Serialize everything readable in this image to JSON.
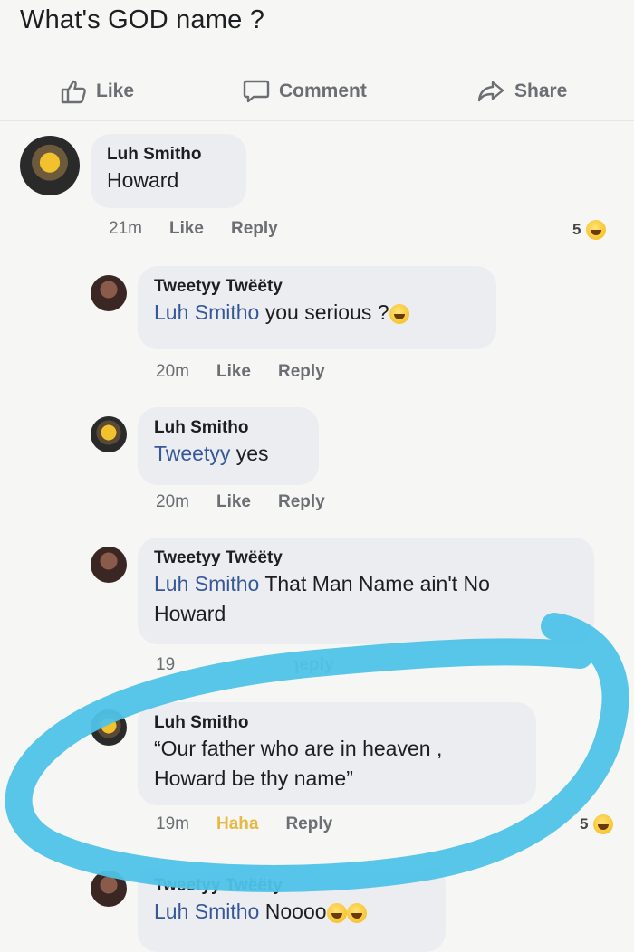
{
  "post": {
    "title": "What's GOD name ?"
  },
  "actions": {
    "like": "Like",
    "comment": "Comment",
    "share": "Share"
  },
  "comments": [
    {
      "author": "Luh Smitho",
      "text": "Howard",
      "time": "21m",
      "like": "Like",
      "reply": "Reply",
      "reactions": "5"
    },
    {
      "author": "Tweetyy Twëëty",
      "mention": "Luh Smitho",
      "text": " you serious ?",
      "time": "20m",
      "like": "Like",
      "reply": "Reply"
    },
    {
      "author": "Luh Smitho",
      "mention": "Tweetyy",
      "text": " yes",
      "time": "20m",
      "like": "Like",
      "reply": "Reply"
    },
    {
      "author": "Tweetyy Twëëty",
      "mention": "Luh Smitho",
      "text": " That Man Name ain't No",
      "text2": "Howard",
      "time": "19",
      "reply": "ɿeply"
    },
    {
      "author": "Luh Smitho",
      "text": "“Our father who are in heaven ,",
      "text2": "Howard be thy name”",
      "time": "19m",
      "like": "Haha",
      "reply": "Reply",
      "reactions": "5"
    },
    {
      "author": "Tweetyy Twëëty",
      "mention": "Luh Smitho",
      "text": " Noooo"
    }
  ],
  "colors": {
    "mention": "#365899",
    "highlight_circle": "#4fc3e8",
    "bubble": "#ebedf0"
  }
}
